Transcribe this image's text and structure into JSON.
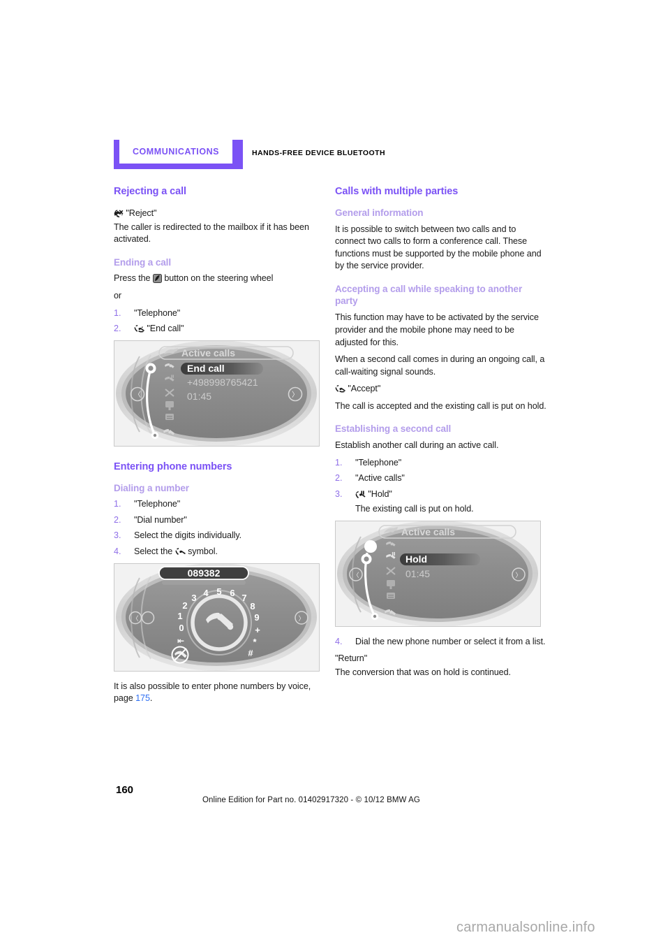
{
  "header": {
    "chapter": "COMMUNICATIONS",
    "section": "HANDS-FREE DEVICE BLUETOOTH"
  },
  "colors": {
    "brand_purple": "#7B52F5",
    "sub_heading_lavender": "#B39DEB",
    "step_number": "#8F6FE8",
    "page_ref_blue": "#2E6FF2"
  },
  "left_column": {
    "h1_rejecting": "Rejecting a call",
    "reject_command": "\"Reject\"",
    "reject_icon": "phone-reject-icon",
    "reject_body": "The caller is redirected to the mailbox if it has been activated.",
    "h2_ending": "Ending a call",
    "ending_press_pre": "Press the",
    "ending_press_icon": "steering-wheel-phone-button-icon",
    "ending_press_post": "button on the steering wheel",
    "ending_or": "or",
    "ending_steps": [
      {
        "text": "\"Telephone\"",
        "icon": null
      },
      {
        "text": "\"End call\"",
        "icon": "phone-end-call-icon"
      }
    ],
    "figure_active_calls": {
      "name": "mini-display-active-calls-end-call",
      "title": "Active calls",
      "selected_label": "End call",
      "phone_number": "+498998765421",
      "duration": "01:45"
    },
    "h1_entering": "Entering phone numbers",
    "h2_dialing": "Dialing a number",
    "dialing_steps": [
      {
        "text": "\"Telephone\"",
        "icon": null
      },
      {
        "text": "\"Dial number\"",
        "icon": null
      },
      {
        "text": "Select the digits individually.",
        "icon": null
      },
      {
        "text_pre": "Select the",
        "icon": "phone-dial-icon",
        "text_post": "symbol."
      }
    ],
    "figure_dialpad": {
      "name": "mini-display-dial-number",
      "entered_number": "089382",
      "digits": [
        "0",
        "1",
        "2",
        "3",
        "4",
        "5",
        "6",
        "7",
        "8",
        "9",
        "+",
        "*",
        "#"
      ],
      "backspace_glyph": "backspace-icon",
      "call_glyph": "phone-handset-icon"
    },
    "closing_pre": "It is also possible to enter phone numbers by voice, page",
    "closing_page_ref": "175",
    "closing_post": "."
  },
  "right_column": {
    "h1_multiple": "Calls with multiple parties",
    "h2_general": "General information",
    "general_body": "It is possible to switch between two calls and to connect two calls to form a conference call. These functions must be supported by the mobile phone and by the service provider.",
    "h2_accepting": "Accepting a call while speaking to another party",
    "accepting_body_1": "This function may have to be activated by the service provider and the mobile phone may need to be adjusted for this.",
    "accepting_body_2": "When a second call comes in during an ongoing call, a call-waiting signal sounds.",
    "accept_icon": "phone-accept-icon",
    "accept_command": "\"Accept\"",
    "accepting_body_3": "The call is accepted and the existing call is put on hold.",
    "h2_establishing": "Establishing a second call",
    "establishing_body": "Establish another call during an active call.",
    "establishing_steps": [
      {
        "text": "\"Telephone\"",
        "icon": null
      },
      {
        "text": "\"Active calls\"",
        "icon": null
      },
      {
        "text": "\"Hold\"",
        "icon": "phone-hold-icon",
        "note": "The existing call is put on hold."
      }
    ],
    "figure_hold": {
      "name": "mini-display-active-calls-hold",
      "title": "Active calls",
      "selected_label": "Hold",
      "duration": "01:45"
    },
    "establishing_step_4": "Dial the new phone number or select it from a list.",
    "return_command": "\"Return\"",
    "return_body": "The conversion that was on hold is continued."
  },
  "footer": {
    "page_number": "160",
    "online_edition": "Online Edition for Part no. 01402917320 - © 10/12 BMW AG",
    "watermark": "carmanualsonline.info"
  }
}
